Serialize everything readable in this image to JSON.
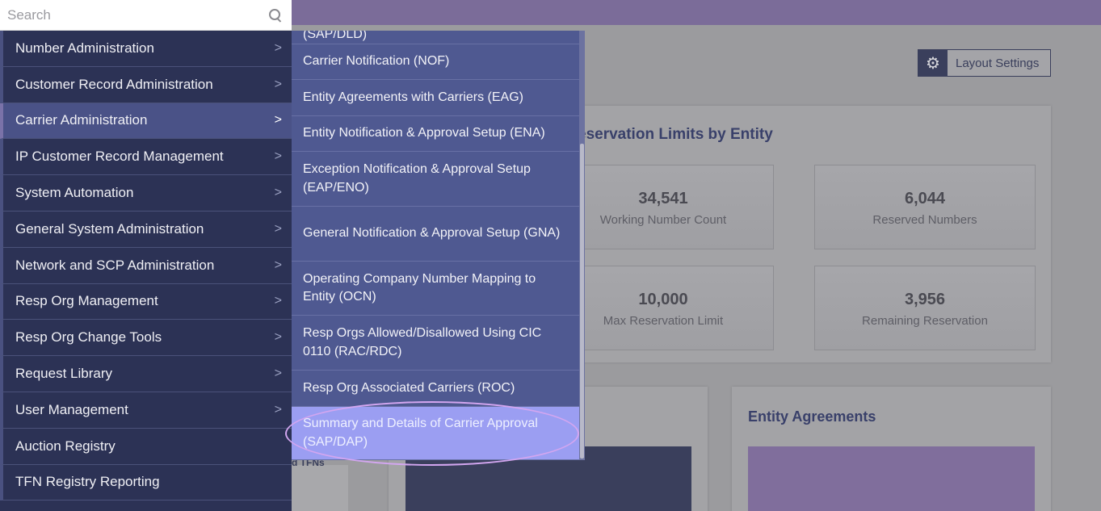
{
  "search": {
    "placeholder": "Search"
  },
  "sidebar": {
    "items": [
      {
        "label": "Number Administration"
      },
      {
        "label": "Customer Record Administration"
      },
      {
        "label": "Carrier Administration"
      },
      {
        "label": "IP Customer Record Management"
      },
      {
        "label": "System Automation"
      },
      {
        "label": "General System Administration"
      },
      {
        "label": "Network and SCP Administration"
      },
      {
        "label": "Resp Org Management"
      },
      {
        "label": "Resp Org Change Tools"
      },
      {
        "label": "Request Library"
      },
      {
        "label": "User Management"
      },
      {
        "label": "Auction Registry"
      },
      {
        "label": "TFN Registry Reporting"
      }
    ],
    "active_index": 2,
    "chevron": ">"
  },
  "submenu": {
    "items": [
      {
        "label": "(SAP/DLD)"
      },
      {
        "label": "Carrier Notification (NOF)"
      },
      {
        "label": "Entity Agreements with Carriers (EAG)"
      },
      {
        "label": "Entity Notification & Approval Setup (ENA)"
      },
      {
        "label": "Exception Notification & Approval Setup (EAP/ENO)"
      },
      {
        "label": "General Notification & Approval Setup (GNA)"
      },
      {
        "label": "Operating Company Number Mapping to Entity (OCN)"
      },
      {
        "label": "Resp Orgs Allowed/Disallowed Using CIC 0110 (RAC/RDC)"
      },
      {
        "label": "Resp Org Associated Carriers (ROC)"
      },
      {
        "label": "Summary and Details of Carrier Approval (SAP/DAP)"
      }
    ],
    "highlighted_index": 9
  },
  "dashboard": {
    "layout_settings_label": "Layout Settings",
    "reservation_card_title": "eservation Limits by Entity",
    "stats": [
      {
        "value": "34,541",
        "label": "Working Number Count"
      },
      {
        "value": "6,044",
        "label": "Reserved Numbers"
      },
      {
        "value": "10,000",
        "label": "Max Reservation Limit"
      },
      {
        "value": "3,956",
        "label": "Remaining Reservation"
      }
    ],
    "entity_agreements_title": "Entity Agreements",
    "left_peek_text": "d TFNs"
  },
  "colors": {
    "sidebar_bg": "#2c3255",
    "submenu_bg": "#4f5991",
    "highlight": "#9b9ef2",
    "topbar": "#7b6c99",
    "annotation_ellipse": "#d3a6f0"
  }
}
